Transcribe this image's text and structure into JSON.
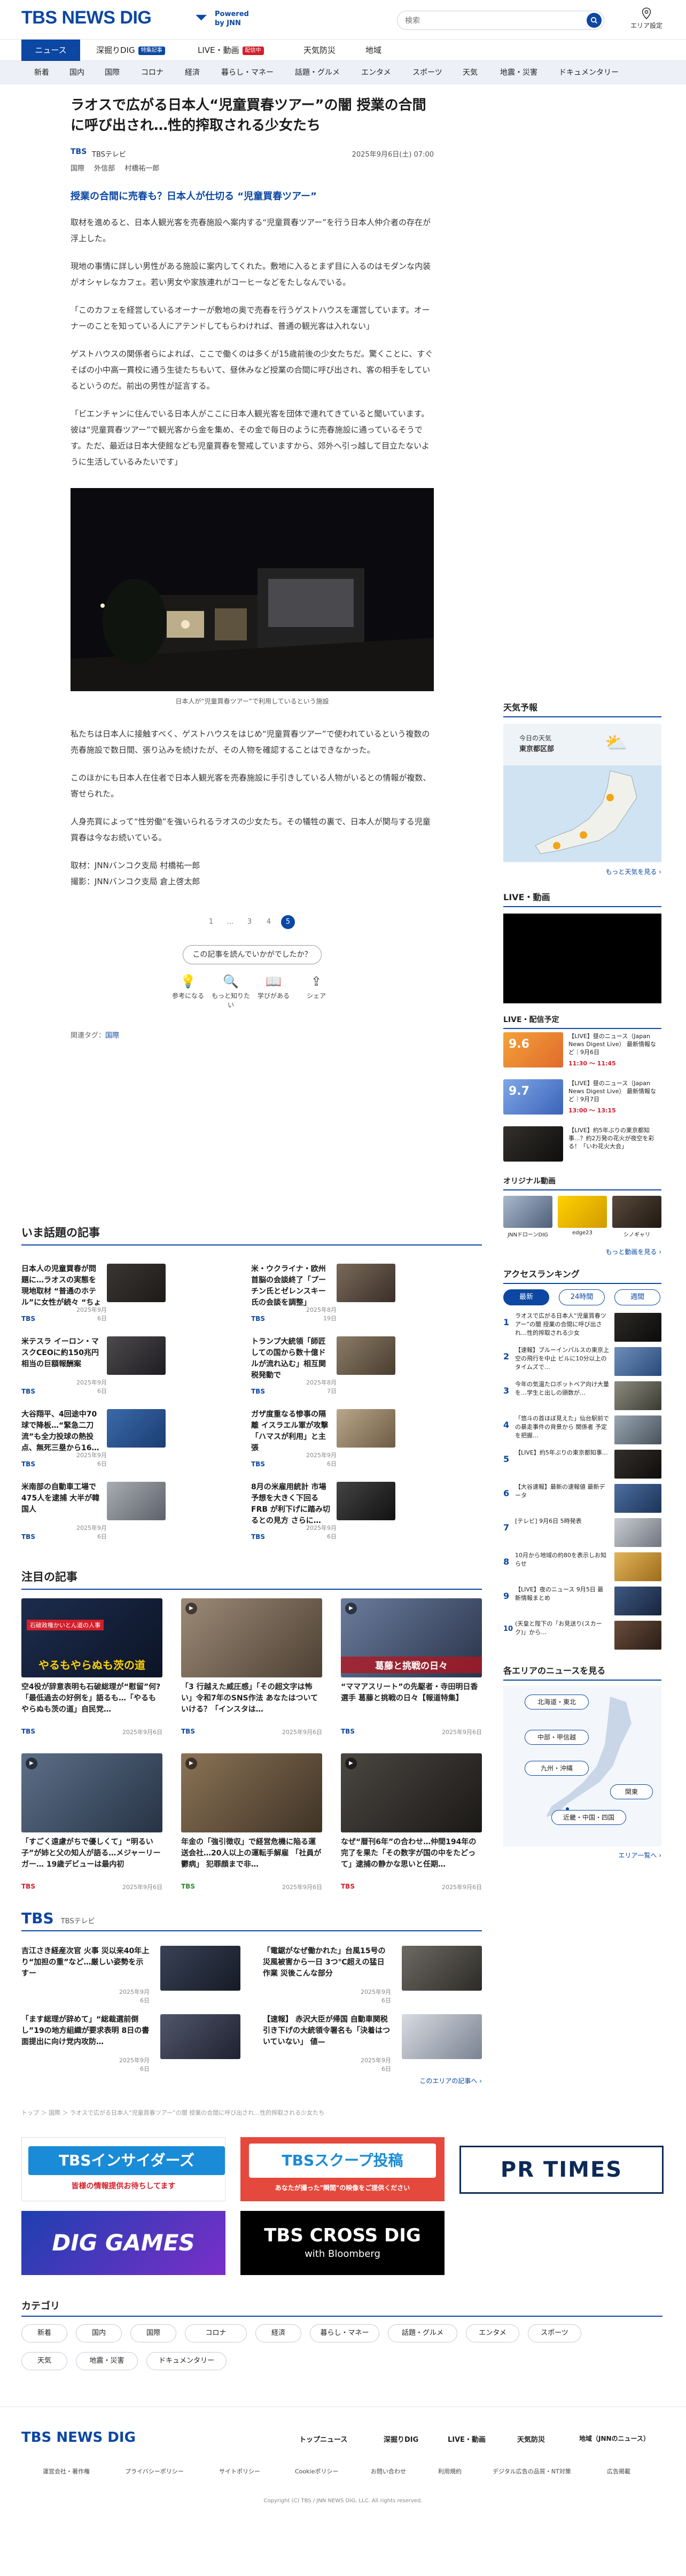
{
  "header": {
    "logo": "TBS NEWS DIG",
    "powered_line1": "Powered",
    "powered_line2": "by JNN",
    "search_placeholder": "検索",
    "area_label": "エリア設定"
  },
  "nav_primary": [
    {
      "label": "ニュース"
    },
    {
      "label": "深掘りDIG",
      "badge": "特集記事"
    },
    {
      "label": "LIVE・動画",
      "badge": "配信中"
    },
    {
      "label": "天気防災"
    },
    {
      "label": "地域"
    }
  ],
  "nav_secondary": [
    "新着",
    "国内",
    "国際",
    "コロナ",
    "経済",
    "暮らし・マネー",
    "話題・グルメ",
    "エンタメ",
    "スポーツ",
    "天気",
    "地震・災害",
    "ドキュメンタリー"
  ],
  "article": {
    "title": "ラオスで広がる日本人“児童買春ツアー”の闇 授業の合間に呼び出され…性的搾取される少女たち",
    "source": "TBS",
    "source_name": "TBSテレビ",
    "date": "2025年9月6日(土) 07:00",
    "tags": [
      "国際",
      "外信部",
      "村橋祐一郎"
    ],
    "subhead": "授業の合間に売春も？日本人が仕切る “児童買春ツアー”",
    "paragraphs": [
      "取材を進めると、日本人観光客を売春施設へ案内する“児童買春ツアー”を行う日本人仲介者の存在が浮上した。",
      "現地の事情に詳しい男性がある施設に案内してくれた。敷地に入るとまず目に入るのはモダンな内装がオシャレなカフェ。若い男女や家族連れがコーヒーなどをたしなんでいる。",
      "「このカフェを経営しているオーナーが敷地の奥で売春を行うゲストハウスを運営しています。オーナーのことを知っている人にアテンドしてもらわければ、普通の観光客は入れない」",
      "ゲストハウスの関係者らによれば、ここで働くのは多くが15歳前後の少女たちだ。驚くことに、すぐそばの小中高一貫校に通う生徒たちもいて、昼休みなど授業の合間に呼び出され、客の相手をしているというのだ。前出の男性が証言する。",
      "「ビエンチャンに住んでいる日本人がここに日本人観光客を団体で連れてきていると聞いています。彼は“児童買春ツアー”で観光客から金を集め、その金で毎日のように売春施設に通っているそうです。ただ、最近は日本大使館なども児童買春を警戒していますから、郊外へ引っ越して目立たないように生活しているみたいです」"
    ],
    "photo_caption": "日本人が“児童買春ツアー”で利用しているという施設",
    "paragraphs2": [
      "私たちは日本人に接触すべく、ゲストハウスをはじめ“児童買春ツアー”で使われているという複数の売春施設で数日間、張り込みを続けたが、その人物を確認することはできなかった。",
      "このほかにも日本人在住者で日本人観光客を売春施設に手引きしている人物がいるとの情報が複数、寄せられた。",
      "人身売買によって“性労働”を強いられるラオスの少女たち。その犠牲の裏で、日本人が関与する児童買春は今なお続いている。",
      "取材：JNNバンコク支局 村橋祐一郎\n撮影：JNNバンコク支局 倉上啓太郎"
    ],
    "pager": [
      "1",
      "…",
      "3",
      "4",
      "5"
    ],
    "read_button": "この記事を読んでいかがでしたか？",
    "reactions": [
      "参考になる",
      "もっと知りたい",
      "学びがある",
      "シェア"
    ],
    "related_tags_label": "関連タグ：",
    "related_tags": [
      "国際"
    ]
  },
  "trending": {
    "title": "いま話題の記事",
    "items": [
      {
        "title": "日本人の児童買春が問題に…ラオスの実態を現地取材 “普通のホテル”に女性が続々 “ちょっと…",
        "source": "TBS",
        "date": "2025年9月6日"
      },
      {
        "title": "米・ウクライナ・欧州首脳の会談終了「プーチン氏とゼレンスキー氏の会談を調整」",
        "source": "TBS",
        "date": "2025年8月19日"
      },
      {
        "title": "米テスラ イーロン・マスクCEOに約150兆円相当の巨額報酬案",
        "source": "TBS",
        "date": "2025年9月6日"
      },
      {
        "title": "トランプ大統領「師匠しての国から数十億ドルが流れ込む」相互関税発動で",
        "source": "TBS",
        "date": "2025年8月7日"
      },
      {
        "title": "大谷翔平、4回途中70球で降板…“緊急二刀流”も全力投球の熱投点、無死三塁から16…",
        "source": "TBS",
        "date": "2025年9月6日"
      },
      {
        "title": "ガザ度重なる惨事の隔離 イスラエル軍が攻撃「ハマスが利用」と主張",
        "source": "TBS",
        "date": "2025年9月6日"
      },
      {
        "title": "米南部の自動車工場で475人を逮捕 大半が韓国人",
        "source": "TBS",
        "date": "2025年9月6日"
      },
      {
        "title": "8月の米雇用統計 市場予想を大きく下回る FRB が利下げに踏み切るとの見方 さらに…",
        "source": "TBS",
        "date": "2025年9月6日"
      }
    ]
  },
  "featured": {
    "title": "注目の記事",
    "items": [
      {
        "title": "空4役が辞意表明も石破総理が“慰留”何?「最低過去の好例を」語るも…「やるもやらぬも茨の道」自民党…",
        "source": "TBS",
        "date": "2025年9月6日",
        "overlay": "やるもやらぬも茨の道",
        "overlay_tag": "石破政権かいとん道の人事"
      },
      {
        "title": "「3 行越えた威圧感」「その超文字は怖い」令和7年のSNS作法 あなたはついていける？「インスタは…",
        "source": "TBS",
        "date": "2025年9月6日",
        "overlay": ""
      },
      {
        "title": "“ママアスリート”の先駆者・寺田明日香選手 葛藤と挑戦の日々【報道特集】",
        "source": "TBS",
        "date": "2025年9月6日",
        "overlay": "葛藤と挑戦の日々"
      },
      {
        "title": "「すごく遠慮がちで優しくて」“明るい子”が姉と父の知人が語る…メジャーリーガー… 19歳デビューは最内初",
        "source": "TBS",
        "date": "2025年9月6日",
        "overlay": ""
      },
      {
        "title": "年金の「強引徴収」で経営危機に陥る運送会社…20人以上の運転手解雇 「社員が鬱病」 犯罪顔まで非…",
        "source": "TBS",
        "date": "2025年9月6日",
        "overlay": ""
      },
      {
        "title": "なぜ“暦刊6年”の合わせ…仲間194年の完了を果た「その数字が国の中をたどって」逮捕の静かな思いと任期…",
        "source": "TBS",
        "date": "2025年9月6日",
        "overlay": ""
      }
    ]
  },
  "tbs_block": {
    "logo": "TBS",
    "name": "TBSテレビ",
    "items": [
      {
        "title": "吉江さき経産次官 火事 災以来40年上り“加担の重”など…厳しい姿勢を示すー",
        "date": "2025年9月6日"
      },
      {
        "title": "「電鋸がなぜ働かれた」台風15号の災風被害から一日 3つ℃超えの猛日作業 災後こんな部分",
        "date": "2025年9月6日"
      },
      {
        "title": "「ます総理が辞めて」“総裁選前倒し”19の地方組織が要求表明 8日の書面提出に向け党内攻防…",
        "date": "2025年9月6日"
      },
      {
        "title": "【速報】 赤沢大臣が帰国 自動車関税引き下げの大統領令署名も「決着はついていない」 値—",
        "date": "2025年9月6日"
      }
    ],
    "more": "このエリアの記事へ ›"
  },
  "breadcrumb": "トップ ＞ 国際 ＞ ラオスで広がる日本人“児童買春ツアー”の闇 授業の合間に呼び出され…性的搾取される少女たち",
  "banners": [
    {
      "name": "TBSインサイダーズ",
      "sub": "皆様の情報提供お待ちしてます"
    },
    {
      "name": "TBSスクープ投稿",
      "sub": "あなたが撮った\"瞬間\"の映像をご提供ください"
    },
    {
      "name": "PR TIMES"
    },
    {
      "name": "DIG GAMES"
    },
    {
      "name": "TBS CROSS DIG",
      "sub": "with Bloomberg"
    }
  ],
  "categories": {
    "title": "カテゴリ",
    "items": [
      "新着",
      "国内",
      "国際",
      "コロナ",
      "経済",
      "暮らし・マネー",
      "話題・グルメ",
      "エンタメ",
      "スポーツ",
      "天気",
      "地震・災害",
      "ドキュメンタリー"
    ]
  },
  "sidebar": {
    "weather_title": "天気予報",
    "weather_today": "今日の天気",
    "weather_region": "東京都区部",
    "weather_more": "もっと天気を見る ›",
    "live_title": "LIVE・動画",
    "live_schedule_title": "LIVE・配信予定",
    "live_items": [
      {
        "date": "9.6",
        "day": "SATURDAY",
        "title": "【LIVE】昼のニュース（Japan News Digest Live） 最新情報など｜9月6日",
        "time": "11:30 〜 11:45"
      },
      {
        "date": "9.7",
        "day": "SUNDAY",
        "title": "【LIVE】昼のニュース（Japan News Digest Live） 最新情報など｜9月7日",
        "time": "13:00 〜 13:15"
      },
      {
        "date": "",
        "day": "",
        "title": "【LIVE】約5年ぶりの東京都知事...？約2万発の花火が夜空を彩る！「いわ花火大会」",
        "time": ""
      }
    ],
    "original_title": "オリジナル動画",
    "original_items": [
      "JNNドローンDIG",
      "edge23",
      "シノギャリ"
    ],
    "original_more": "もっと動画を見る ›",
    "ranking_title": "アクセスランキング",
    "ranking_tabs": [
      "最新",
      "24時間",
      "週間"
    ],
    "ranking": [
      "ラオスで広がる日本人“児童買春ツアー”の闇 授業の合間に呼び出され…性的搾取される少女",
      "【速報】ブルーインパルスの東京上空の飛行を中止 ビルに10分以上のタイムズで…",
      "今年の気温たロボットベア向け大量を…学生と出しの頭数が…",
      "「悠斗の首ほぼ見えた」仙台駅前での暴走事件の背景から 関係者 予定を把握…",
      "【LIVE】約5年ぶりの東京都知事...",
      "【大谷速報】最新の速報値 最新データ",
      "[テレビ] 9月6日 5時発表",
      "10月から地域の約80を表示しお知らせ",
      "【LIVE】夜のニュース 9月5日 最新情報まとめ",
      "(天皇と陛下の「お見送り(スカーク)」から…"
    ],
    "area_title": "各エリアのニュースを見る",
    "areas": [
      "北海道・東北",
      "中部・甲信越",
      "九州・沖縄",
      "関東",
      "近畿・中国・四国"
    ],
    "area_more": "エリア一覧へ ›"
  },
  "footer": {
    "logo": "TBS NEWS DIG",
    "nav": [
      "トップニュース",
      "深掘りDIG",
      "LIVE・動画",
      "天気防災",
      "地域（JNNのニュース）"
    ],
    "links": [
      "運営会社・著作権",
      "プライバシーポリシー",
      "サイトポリシー",
      "Cookieポリシー",
      "お問い合わせ",
      "利用規約",
      "デジタル広告の品質・NT対策",
      "広告掲載"
    ],
    "copyright": "Copyright (C) TBS / JNN NEWS DIG, LLC. All rights reserved."
  },
  "colors": {
    "brand": "#0b47a3",
    "accent_red": "#d21f2b",
    "nav_bg": "#edf0f6"
  }
}
